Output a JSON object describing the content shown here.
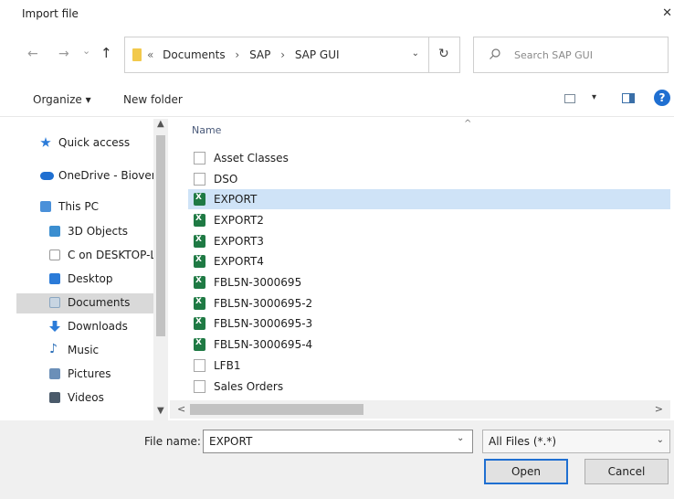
{
  "window": {
    "title": "Import file",
    "close": "✕"
  },
  "nav": {
    "back": "←",
    "forward": "→",
    "recent": "⌄",
    "up": "↑",
    "crumb_prefix": "«",
    "breadcrumb": [
      "Documents",
      "SAP",
      "SAP GUI"
    ],
    "crumb_sep": "›",
    "address_dropdown": "⌄",
    "refresh": "↻",
    "search_placeholder": "Search SAP GUI"
  },
  "toolbar": {
    "organize": "Organize ▾",
    "new_folder": "New folder",
    "view_dropdown": "▾",
    "help": "?"
  },
  "sidebar": {
    "items": [
      {
        "label": "Quick access",
        "icon": "star-icon",
        "color": "#2b7bd8"
      },
      {
        "label": "OneDrive - Biover",
        "icon": "cloud-icon",
        "color": "#1f6fd1"
      },
      {
        "label": "This PC",
        "icon": "computer-icon",
        "color": "#4a90d9"
      },
      {
        "label": "3D Objects",
        "icon": "cube-icon",
        "color": "#3b8ed0"
      },
      {
        "label": "C on DESKTOP-L",
        "icon": "drive-icon",
        "color": "#d0d0d0"
      },
      {
        "label": "Desktop",
        "icon": "desktop-icon",
        "color": "#2b7bd8"
      },
      {
        "label": "Documents",
        "icon": "documents-icon",
        "color": "#8aa6c1"
      },
      {
        "label": "Downloads",
        "icon": "download-icon",
        "color": "#2b7bd8"
      },
      {
        "label": "Music",
        "icon": "music-icon",
        "color": "#2b6fb8"
      },
      {
        "label": "Pictures",
        "icon": "pictures-icon",
        "color": "#6b8fb8"
      },
      {
        "label": "Videos",
        "icon": "video-icon",
        "color": "#4a5a6a"
      }
    ],
    "selected": "Documents"
  },
  "filelist": {
    "column": "Name",
    "files": [
      {
        "name": "Asset Classes",
        "type": "doc"
      },
      {
        "name": "DSO",
        "type": "doc"
      },
      {
        "name": "EXPORT",
        "type": "xlsx"
      },
      {
        "name": "EXPORT2",
        "type": "xlsx"
      },
      {
        "name": "EXPORT3",
        "type": "xlsx"
      },
      {
        "name": "EXPORT4",
        "type": "xlsx"
      },
      {
        "name": "FBL5N-3000695",
        "type": "xlsx"
      },
      {
        "name": "FBL5N-3000695-2",
        "type": "xlsx"
      },
      {
        "name": "FBL5N-3000695-3",
        "type": "xlsx"
      },
      {
        "name": "FBL5N-3000695-4",
        "type": "xlsx"
      },
      {
        "name": "LFB1",
        "type": "doc"
      },
      {
        "name": "Sales Orders",
        "type": "doc"
      }
    ],
    "selected": "EXPORT"
  },
  "footer": {
    "filename_label": "File name:",
    "filename_value": "EXPORT",
    "filter_value": "All Files (*.*)",
    "open_label": "Open",
    "cancel_label": "Cancel"
  },
  "colors": {
    "selection": "#cfe3f7",
    "accent": "#1f6fd1",
    "excel": "#1f7a44"
  }
}
